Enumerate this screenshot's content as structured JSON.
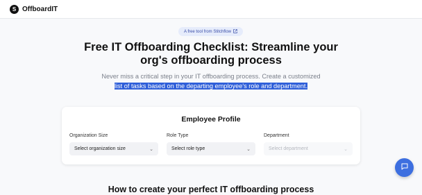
{
  "header": {
    "logo_letter": "S",
    "brand": "OffboardIT"
  },
  "badge": {
    "text": "A free tool from Stitchflow",
    "icon": "external-link-icon"
  },
  "hero": {
    "title_line1": "Free IT Offboarding Checklist: Streamline your",
    "title_line2": "org's offboarding process",
    "subtitle_line1": "Never miss a critical step in your IT offboarding process. Create a customized",
    "subtitle_line2_selected": "list of tasks based on the departing employee's role and department."
  },
  "profile_card": {
    "title": "Employee Profile",
    "fields": [
      {
        "label": "Organization Size",
        "placeholder": "Select organization size"
      },
      {
        "label": "Role Type",
        "placeholder": "Select role type"
      },
      {
        "label": "Department",
        "placeholder": "Select department"
      }
    ]
  },
  "section": {
    "heading": "How to create your perfect IT offboarding process"
  },
  "chat": {
    "icon": "chat-bubble-icon"
  },
  "colors": {
    "accent": "#3d6fe0",
    "selection": "#2f5fd9",
    "badge_bg": "#e6ecfb"
  }
}
